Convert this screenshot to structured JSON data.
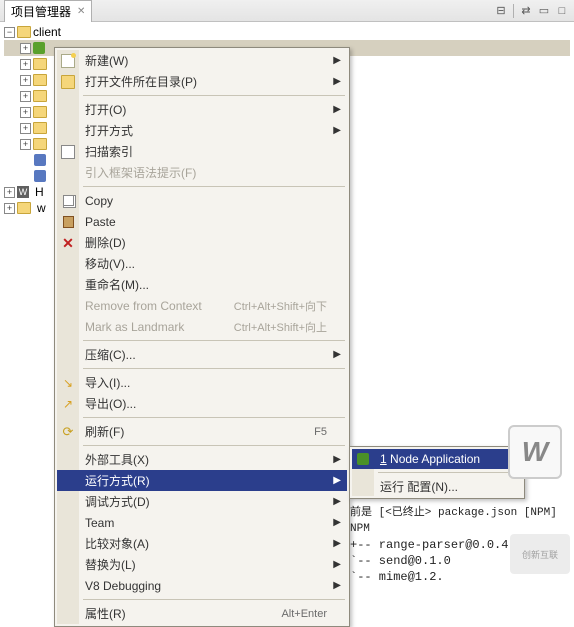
{
  "view": {
    "title": "项目管理器",
    "toolbar": {
      "collapse_icon": "collapse-icon",
      "link_icon": "link-icon",
      "min_icon": "minimize-icon",
      "max_icon": "maximize-icon"
    }
  },
  "tree": {
    "root": {
      "label": "client"
    },
    "partial_nodes": [
      "H",
      "w"
    ]
  },
  "menu": {
    "items": [
      {
        "label": "新建(W)",
        "icon": "new-icon",
        "sub": true
      },
      {
        "label": "打开文件所在目录(P)",
        "icon": "folder-icon",
        "sub": true
      },
      {
        "sep": true
      },
      {
        "label": "打开(O)",
        "sub": true
      },
      {
        "label": "打开方式",
        "sub": true
      },
      {
        "label": "扫描索引",
        "icon": "page-icon"
      },
      {
        "label": "引入框架语法提示(F)",
        "disabled": true
      },
      {
        "sep": true
      },
      {
        "label": "Copy",
        "icon": "copy-icon"
      },
      {
        "label": "Paste",
        "icon": "paste-icon"
      },
      {
        "label": "删除(D)",
        "icon": "delete-icon"
      },
      {
        "label": "移动(V)..."
      },
      {
        "label": "重命名(M)..."
      },
      {
        "label": "Remove from Context",
        "accel": "Ctrl+Alt+Shift+向下",
        "disabled": true
      },
      {
        "label": "Mark as Landmark",
        "accel": "Ctrl+Alt+Shift+向上",
        "disabled": true
      },
      {
        "sep": true
      },
      {
        "label": "压缩(C)...",
        "sub": true
      },
      {
        "sep": true
      },
      {
        "label": "导入(I)...",
        "icon": "import-icon"
      },
      {
        "label": "导出(O)...",
        "icon": "export-icon"
      },
      {
        "sep": true
      },
      {
        "label": "刷新(F)",
        "icon": "refresh-icon",
        "accel": "F5"
      },
      {
        "sep": true
      },
      {
        "label": "外部工具(X)",
        "sub": true
      },
      {
        "label": "运行方式(R)",
        "sub": true,
        "highlight": true
      },
      {
        "label": "调试方式(D)",
        "sub": true
      },
      {
        "label": "Team",
        "sub": true
      },
      {
        "label": "比较对象(A)",
        "sub": true
      },
      {
        "label": "替换为(L)",
        "sub": true
      },
      {
        "label": "V8 Debugging",
        "sub": true
      },
      {
        "sep": true
      },
      {
        "label": "属性(R)",
        "accel": "Alt+Enter"
      }
    ]
  },
  "submenu": {
    "items": [
      {
        "label": "1 Node Application",
        "icon": "node-icon",
        "highlight": true,
        "underline_first": true
      },
      {
        "sep": true
      },
      {
        "label": "运行 配置(N)..."
      }
    ]
  },
  "console": {
    "header": "前是 [<已终止> package.json [NPM] NPM",
    "lines": [
      "+-- range-parser@0.0.4",
      "`-- send@0.1.0",
      "   `-- mime@1.2."
    ]
  },
  "watermark_text": "创新互联",
  "watermark_w": "W"
}
